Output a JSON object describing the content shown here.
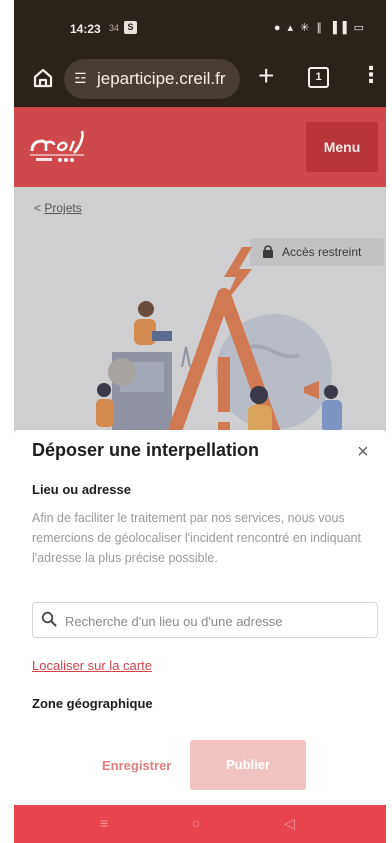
{
  "status_bar": {
    "time": "14:23",
    "mini": "34",
    "badge": "S",
    "icons": "● ▴ ✳ ∥ ▐▐ ▭"
  },
  "browser": {
    "url": "jeparticipe.creil.fr",
    "tab_count": "1",
    "plus": "+",
    "more": "⋮",
    "tune": "☲"
  },
  "header": {
    "menu_label": "Menu"
  },
  "page": {
    "breadcrumb_chevron": "<",
    "breadcrumb_label": "Projets",
    "restricted_label": "Accès restreint"
  },
  "modal": {
    "title": "Déposer une interpellation",
    "close": "×",
    "field_label": "Lieu ou adresse",
    "help_text": "Afin de faciliter le traitement par nos services, nous vous remercions de géolocaliser l'incident rencontré en indiquant l'adresse la plus précise possible.",
    "search_placeholder": "Recherche d'un lieu ou d'une adresse",
    "map_link": "Localiser sur la carte",
    "zone_label": "Zone géographique",
    "save_label": "Enregistrer",
    "publish_label": "Publier"
  },
  "nav_bar": {
    "recents": "≡",
    "home": "○",
    "back": "◁"
  },
  "colors": {
    "brand": "#cf494b",
    "menu_button": "#b93437",
    "publish_disabled": "#f2c1c2",
    "link": "#d0474a",
    "nav_bar": "#e8454d"
  }
}
